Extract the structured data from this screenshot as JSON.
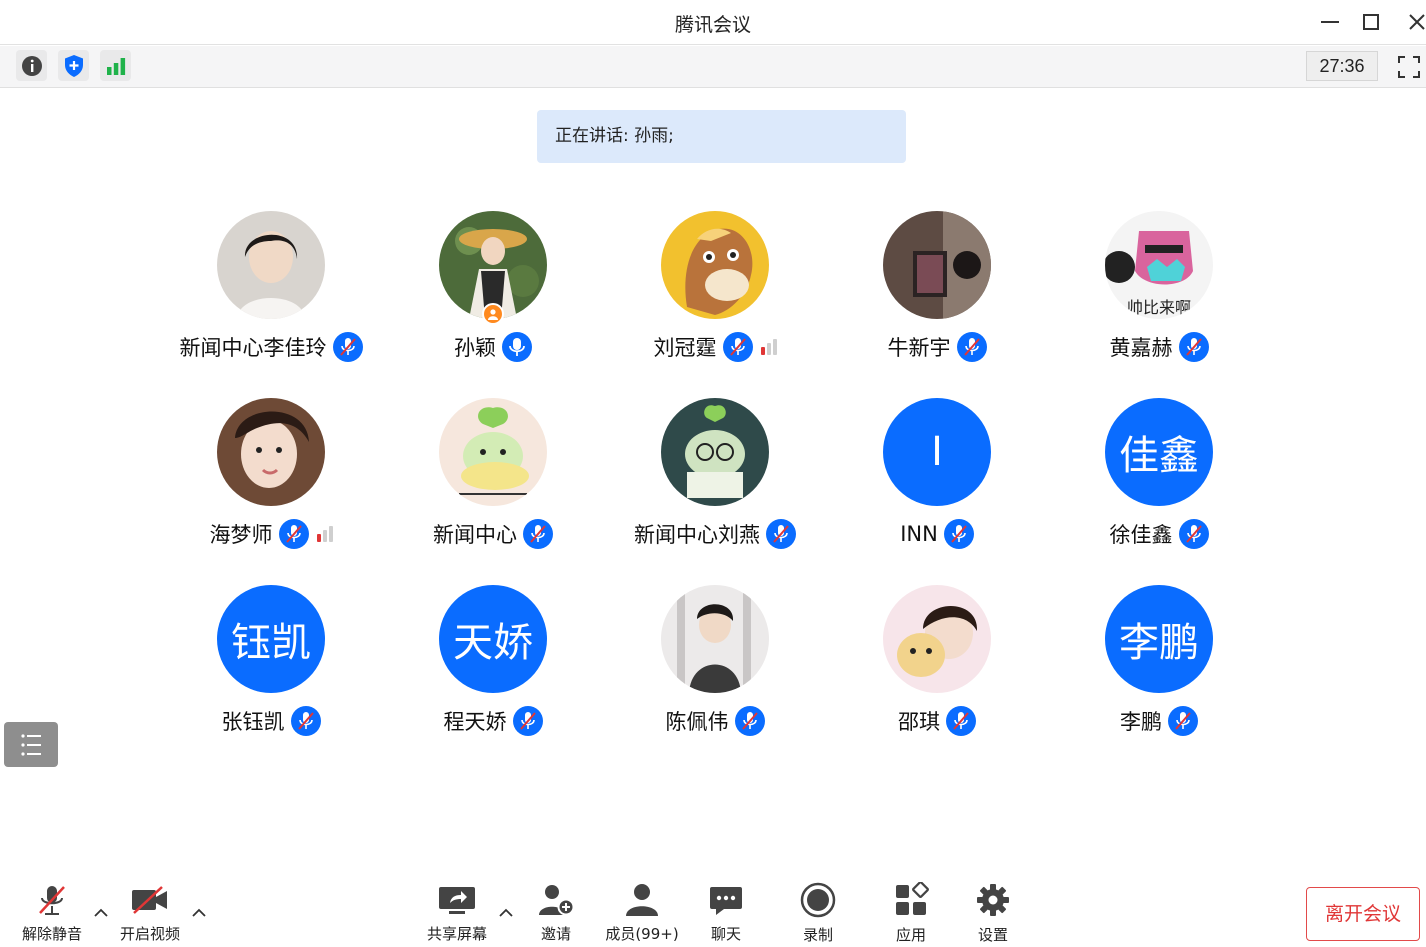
{
  "window": {
    "title": "腾讯会议"
  },
  "infobar": {
    "timer": "27:36"
  },
  "speaking": {
    "text": "正在讲话: 孙雨;"
  },
  "participants": [
    {
      "name": "新闻中心李佳玲",
      "avatar": "photo",
      "mic": "muted",
      "signal": null
    },
    {
      "name": "孙颖",
      "avatar": "photo",
      "mic": "on",
      "host": true,
      "signal": null
    },
    {
      "name": "刘冠霆",
      "avatar": "photo",
      "mic": "muted",
      "signal": 1
    },
    {
      "name": "牛新宇",
      "avatar": "photo",
      "mic": "muted",
      "signal": null
    },
    {
      "name": "黄嘉赫",
      "avatar": "photo",
      "mic": "muted",
      "signal": null,
      "avatar_text": "帅比来啊"
    },
    {
      "name": "海梦师",
      "avatar": "photo",
      "mic": "muted",
      "signal": 1
    },
    {
      "name": "新闻中心",
      "avatar": "photo",
      "mic": "muted",
      "signal": null
    },
    {
      "name": "新闻中心刘燕",
      "avatar": "photo",
      "mic": "muted",
      "signal": null
    },
    {
      "name": "INN",
      "avatar": "initials",
      "initials": "I",
      "mic": "muted",
      "signal": null
    },
    {
      "name": "徐佳鑫",
      "avatar": "initials",
      "initials": "佳鑫",
      "mic": "muted",
      "signal": null
    },
    {
      "name": "张钰凯",
      "avatar": "initials",
      "initials": "钰凯",
      "mic": "muted",
      "signal": null
    },
    {
      "name": "程天娇",
      "avatar": "initials",
      "initials": "天娇",
      "mic": "muted",
      "signal": null
    },
    {
      "name": "陈佩伟",
      "avatar": "photo",
      "mic": "muted",
      "signal": null
    },
    {
      "name": "邵琪",
      "avatar": "photo",
      "mic": "muted",
      "signal": null
    },
    {
      "name": "李鹏",
      "avatar": "initials",
      "initials": "李鹏",
      "mic": "muted",
      "signal": null
    }
  ],
  "toolbar": {
    "unmute": "解除静音",
    "start_video": "开启视频",
    "share_screen": "共享屏幕",
    "invite": "邀请",
    "members": "成员(99+)",
    "chat": "聊天",
    "record": "录制",
    "apps": "应用",
    "settings": "设置",
    "leave": "离开会议"
  },
  "colors": {
    "accent": "#0a6cff",
    "banner": "#dce9fb",
    "danger": "#e03636",
    "signal_good": "#1fb24a"
  }
}
